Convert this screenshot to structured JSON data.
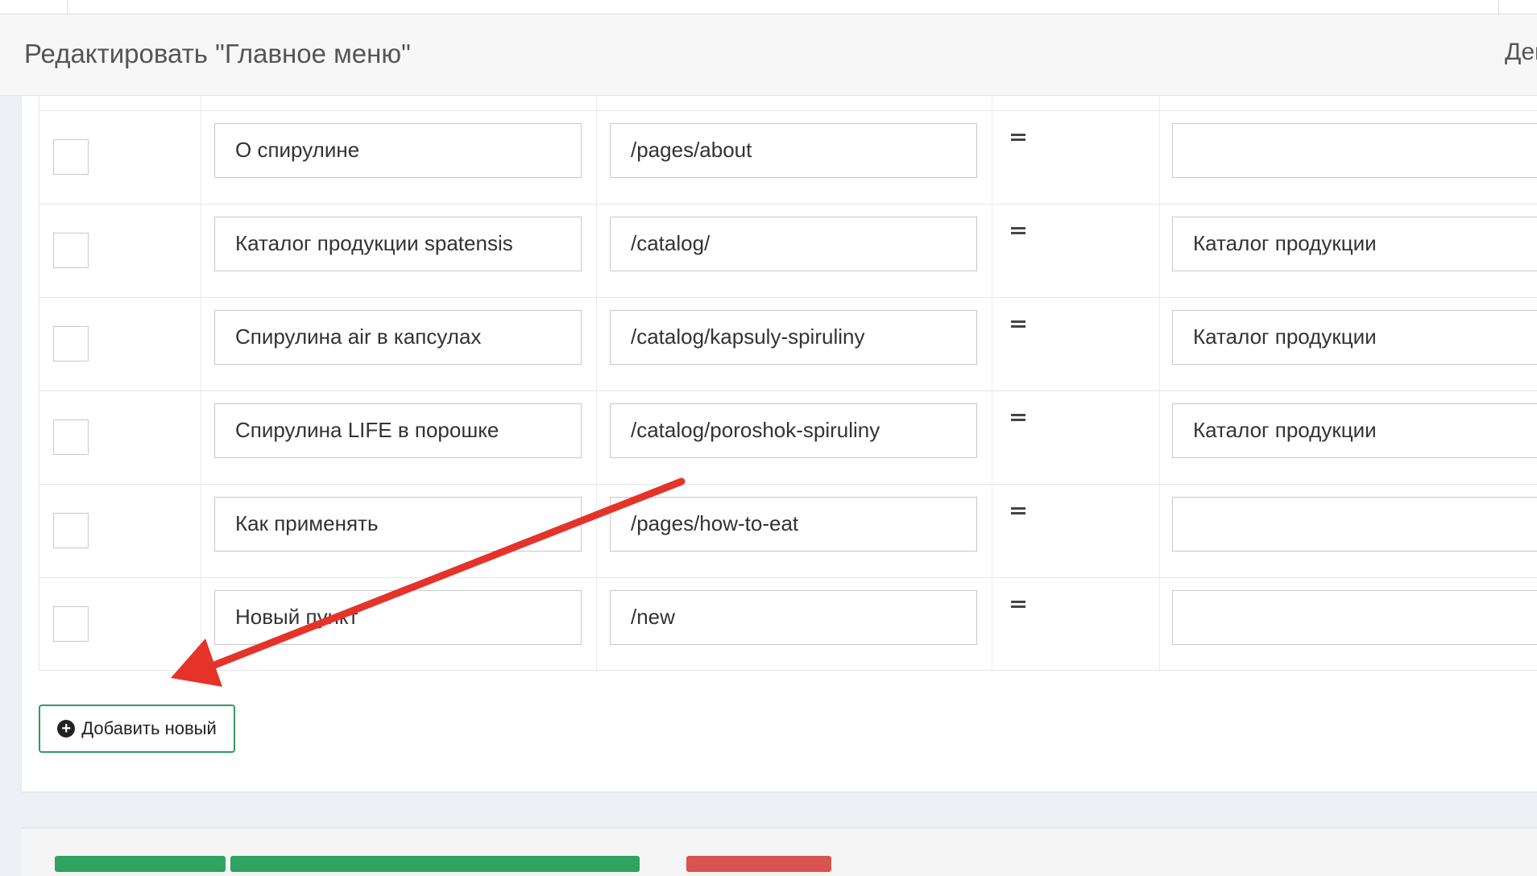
{
  "header": {
    "title": "Редактировать \"Главное меню\"",
    "actions_label": "Дей"
  },
  "menu_items": [
    {
      "title": "О спирулине",
      "url": "/pages/about",
      "parent": ""
    },
    {
      "title": "Каталог продукции spatensis",
      "url": "/catalog/",
      "parent": "Каталог продукции"
    },
    {
      "title": "Спирулина  air в капсулах",
      "url": "/catalog/kapsuly-spiruliny",
      "parent": "Каталог продукции"
    },
    {
      "title": "Спирулина LIFE в порошке",
      "url": "/catalog/poroshok-spiruliny",
      "parent": "Каталог продукции"
    },
    {
      "title": "Как применять",
      "url": "/pages/how-to-eat",
      "parent": ""
    },
    {
      "title": "Новый пункт",
      "url": "/new",
      "parent": ""
    }
  ],
  "add_button": {
    "label": "Добавить новый",
    "icon": "plus-circle-icon"
  },
  "colors": {
    "accent_green": "#2e9d5e",
    "save_green": "#2fa35f",
    "delete_red": "#d9534f",
    "annotation_red": "#e5332a"
  }
}
